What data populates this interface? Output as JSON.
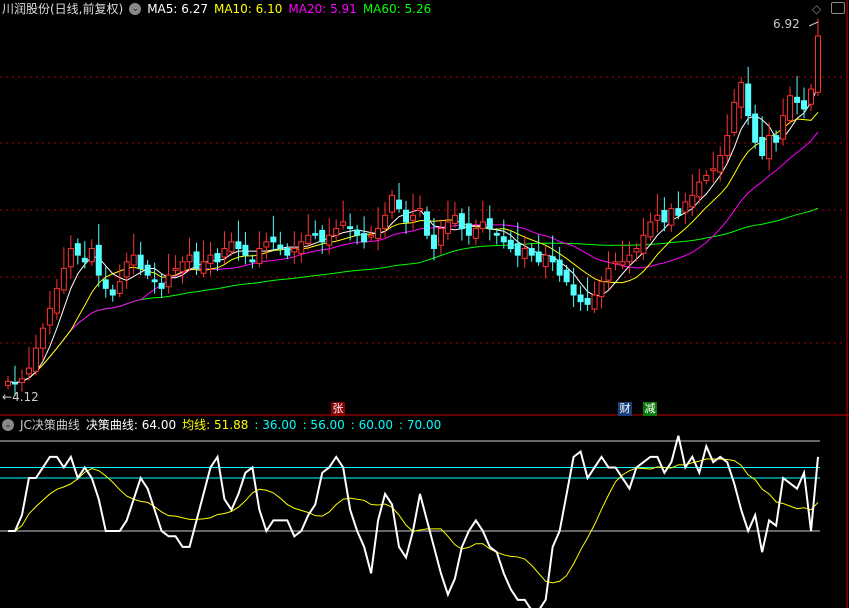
{
  "top": {
    "title": "川润股份(日线,前复权)",
    "ma5": "MA5: 6.27",
    "ma10": "MA10: 6.10",
    "ma20": "MA20: 5.91",
    "ma60": "MA60: 5.26",
    "max_label": "6.92",
    "min_label": "4.12"
  },
  "bottom": {
    "indicator": "JC决策曲线",
    "curve": "决策曲线: 64.00",
    "avg": "均线: 51.88",
    "levels": [
      ": 36.00",
      ": 56.00",
      ": 60.00",
      ": 70.00"
    ]
  },
  "markers": [
    "张",
    "财",
    "减"
  ],
  "colors": {
    "up": "#ff3232",
    "down": "#54ffff",
    "ma5": "#ffffff",
    "ma10": "#ffff00",
    "ma20": "#ff00ff",
    "ma60": "#00ff00",
    "grid": "#b00000"
  },
  "chart_data": [
    {
      "type": "candlestick",
      "title": "川润股份(日线,前复权)",
      "ylim": [
        4.12,
        6.92
      ],
      "close": [
        4.2,
        4.18,
        4.22,
        4.3,
        4.45,
        4.6,
        4.75,
        4.9,
        5.05,
        5.2,
        5.15,
        5.1,
        5.2,
        5.0,
        4.9,
        4.85,
        4.95,
        5.1,
        5.15,
        5.05,
        5.0,
        4.95,
        4.9,
        5.0,
        5.05,
        5.1,
        5.15,
        5.05,
        5.1,
        5.15,
        5.1,
        5.2,
        5.25,
        5.2,
        5.15,
        5.1,
        5.2,
        5.25,
        5.25,
        5.2,
        5.15,
        5.2,
        5.25,
        5.3,
        5.3,
        5.25,
        5.3,
        5.35,
        5.4,
        5.35,
        5.3,
        5.25,
        5.3,
        5.35,
        5.45,
        5.6,
        5.5,
        5.4,
        5.45,
        5.5,
        5.3,
        5.2,
        5.35,
        5.4,
        5.45,
        5.35,
        5.3,
        5.35,
        5.4,
        5.35,
        5.3,
        5.25,
        5.2,
        5.15,
        5.2,
        5.15,
        5.1,
        5.15,
        5.1,
        5.0,
        4.95,
        4.85,
        4.8,
        4.78,
        4.85,
        4.95,
        5.05,
        5.1,
        5.1,
        5.15,
        5.2,
        5.3,
        5.4,
        5.45,
        5.4,
        5.5,
        5.45,
        5.55,
        5.6,
        5.7,
        5.75,
        5.8,
        5.9,
        6.05,
        6.3,
        6.45,
        6.2,
        6.0,
        5.9,
        6.05,
        6.0,
        6.2,
        6.35,
        6.3,
        6.25,
        6.4,
        6.8
      ]
    },
    {
      "type": "line",
      "title": "JC决策曲线",
      "ylim": [
        5,
        75
      ],
      "hlines": [
        36,
        56,
        60,
        70
      ],
      "curve": [
        36,
        36,
        42,
        56,
        56,
        60,
        64,
        64,
        60,
        64,
        56,
        60,
        56,
        48,
        36,
        36,
        36,
        40,
        48,
        56,
        52,
        44,
        36,
        34,
        34,
        30,
        30,
        40,
        50,
        60,
        64,
        48,
        44,
        50,
        58,
        60,
        44,
        36,
        40,
        40,
        40,
        34,
        36,
        42,
        46,
        58,
        60,
        64,
        60,
        44,
        36,
        30,
        20,
        40,
        50,
        46,
        30,
        26,
        36,
        50,
        40,
        30,
        20,
        12,
        18,
        30,
        36,
        40,
        36,
        30,
        28,
        20,
        14,
        10,
        10,
        6,
        6,
        10,
        30,
        36,
        50,
        64,
        66,
        56,
        60,
        64,
        60,
        60,
        56,
        52,
        60,
        62,
        64,
        64,
        58,
        62,
        72,
        60,
        64,
        58,
        68,
        62,
        64,
        62,
        54,
        44,
        36,
        42,
        28,
        40,
        38,
        56,
        54,
        52,
        58,
        36,
        64
      ]
    }
  ]
}
